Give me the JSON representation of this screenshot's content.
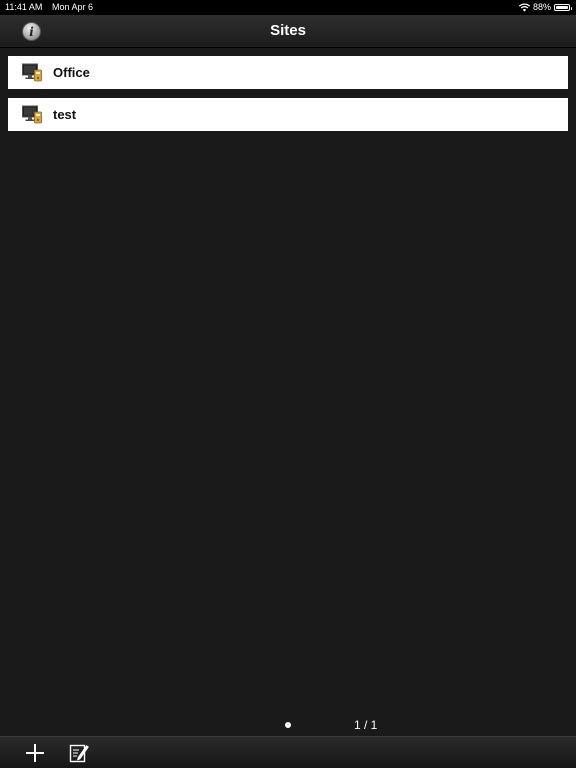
{
  "status_bar": {
    "time": "11:41 AM",
    "date": "Mon Apr 6",
    "battery": "88%",
    "icons": [
      "wifi-icon",
      "battery-icon"
    ]
  },
  "nav": {
    "title": "Sites",
    "info_button_icon": "info-icon"
  },
  "sites": [
    {
      "label": "Office",
      "icon": "site-monitor-icon"
    },
    {
      "label": "test",
      "icon": "site-monitor-icon"
    }
  ],
  "pager": {
    "current_page_indicator": 1,
    "counter": "1 / 1"
  },
  "toolbar": {
    "add_icon": "add-icon",
    "edit_icon": "edit-icon"
  },
  "colors": {
    "background": "#1a1a1a",
    "row_background": "#ffffff",
    "text_light": "#ffffff",
    "text_dark": "#111111"
  }
}
